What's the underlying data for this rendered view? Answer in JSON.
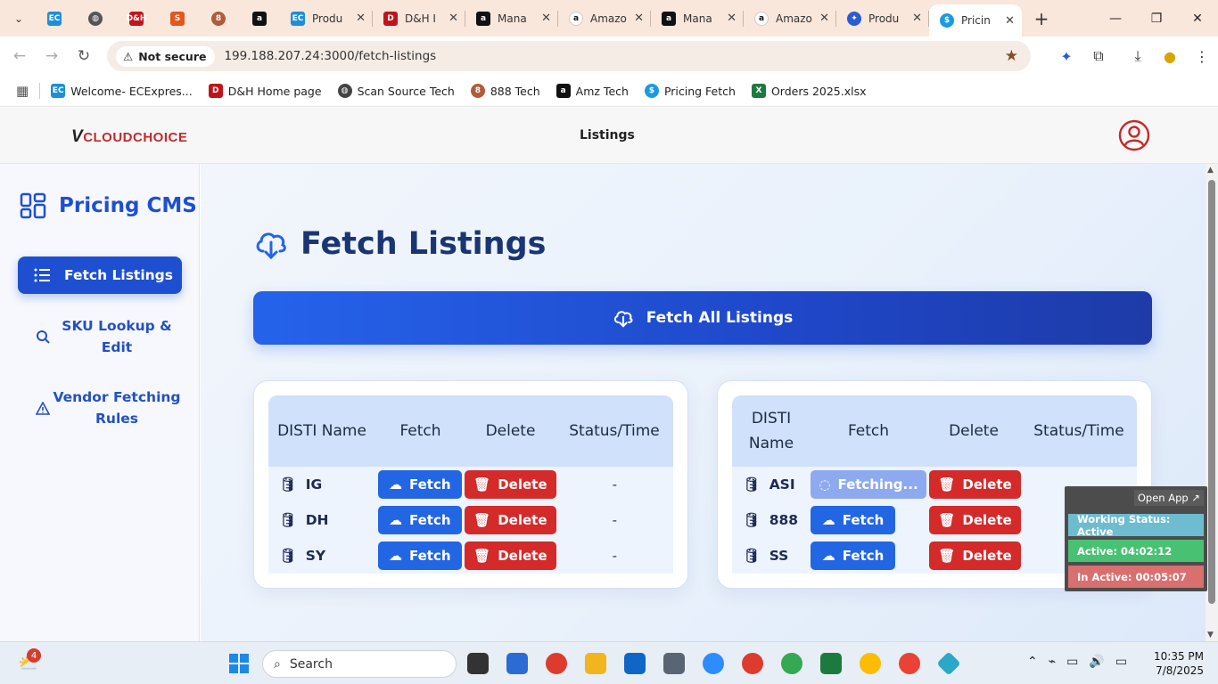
{
  "browser": {
    "pinned_tabs": [
      "ec-icon",
      "globe-icon",
      "dh-icon",
      "swirl-icon",
      "888-icon",
      "amazon-icon"
    ],
    "tabs": [
      {
        "title": "Produ",
        "icon": "ec-icon",
        "active": false
      },
      {
        "title": "D&H I",
        "icon": "dh-icon",
        "active": false
      },
      {
        "title": "Mana",
        "icon": "amazon-icon",
        "active": false
      },
      {
        "title": "Amazo",
        "icon": "amazon-icon",
        "active": false
      },
      {
        "title": "Mana",
        "icon": "amazon-icon",
        "active": false
      },
      {
        "title": "Amazo",
        "icon": "amazon-icon",
        "active": false
      },
      {
        "title": "Produ",
        "icon": "chrome-app-icon",
        "active": false
      },
      {
        "title": "Pricin",
        "icon": "dollar-icon",
        "active": true
      }
    ],
    "security_label": "Not secure",
    "url": "199.188.207.24:3000/fetch-listings",
    "bookmarks": [
      {
        "label": "Welcome- ECExpres...",
        "icon": "ec-icon"
      },
      {
        "label": "D&H Home page",
        "icon": "dh-icon"
      },
      {
        "label": "Scan Source Tech",
        "icon": "globe-icon"
      },
      {
        "label": "888 Tech",
        "icon": "888-icon"
      },
      {
        "label": "Amz Tech",
        "icon": "amazon-icon"
      },
      {
        "label": "Pricing Fetch",
        "icon": "dollar-icon"
      },
      {
        "label": "Orders 2025.xlsx",
        "icon": "excel-icon"
      }
    ]
  },
  "header": {
    "logo_text": "CLOUDCHOICE",
    "nav_label": "Listings"
  },
  "sidebar": {
    "brand": "Pricing CMS",
    "items": [
      {
        "label": "Fetch Listings",
        "icon": "list-icon",
        "active": true
      },
      {
        "label": "SKU Lookup & Edit",
        "icon": "search-icon",
        "active": false
      },
      {
        "label": "Vendor Fetching Rules",
        "icon": "warning-icon",
        "active": false
      }
    ]
  },
  "main": {
    "title": "Fetch Listings",
    "fetch_all_label": "Fetch All Listings",
    "columns": [
      "DISTI Name",
      "Fetch",
      "Delete",
      "Status/Time"
    ],
    "left_rows": [
      {
        "name": "IG",
        "fetch_label": "Fetch",
        "delete_label": "Delete",
        "status": "-"
      },
      {
        "name": "DH",
        "fetch_label": "Fetch",
        "delete_label": "Delete",
        "status": "-"
      },
      {
        "name": "SY",
        "fetch_label": "Fetch",
        "delete_label": "Delete",
        "status": "-"
      }
    ],
    "right_rows": [
      {
        "name": "ASI",
        "fetch_label": "Fetching...",
        "delete_label": "Delete",
        "status": ""
      },
      {
        "name": "888",
        "fetch_label": "Fetch",
        "delete_label": "Delete",
        "status": ""
      },
      {
        "name": "SS",
        "fetch_label": "Fetch",
        "delete_label": "Delete",
        "status": ""
      }
    ]
  },
  "widget": {
    "open_app": "Open App ↗",
    "working_status": "Working Status: Active",
    "active": "Active: 04:02:12",
    "inactive": "In Active: 00:05:07"
  },
  "taskbar": {
    "badge": "4",
    "search_placeholder": "Search",
    "time": "10:35 PM",
    "date": "7/8/2025"
  },
  "colors": {
    "primary": "#1f4fd1",
    "fetch_button": "#2366e4",
    "delete_button": "#d42a2a",
    "title": "#1a3573"
  }
}
